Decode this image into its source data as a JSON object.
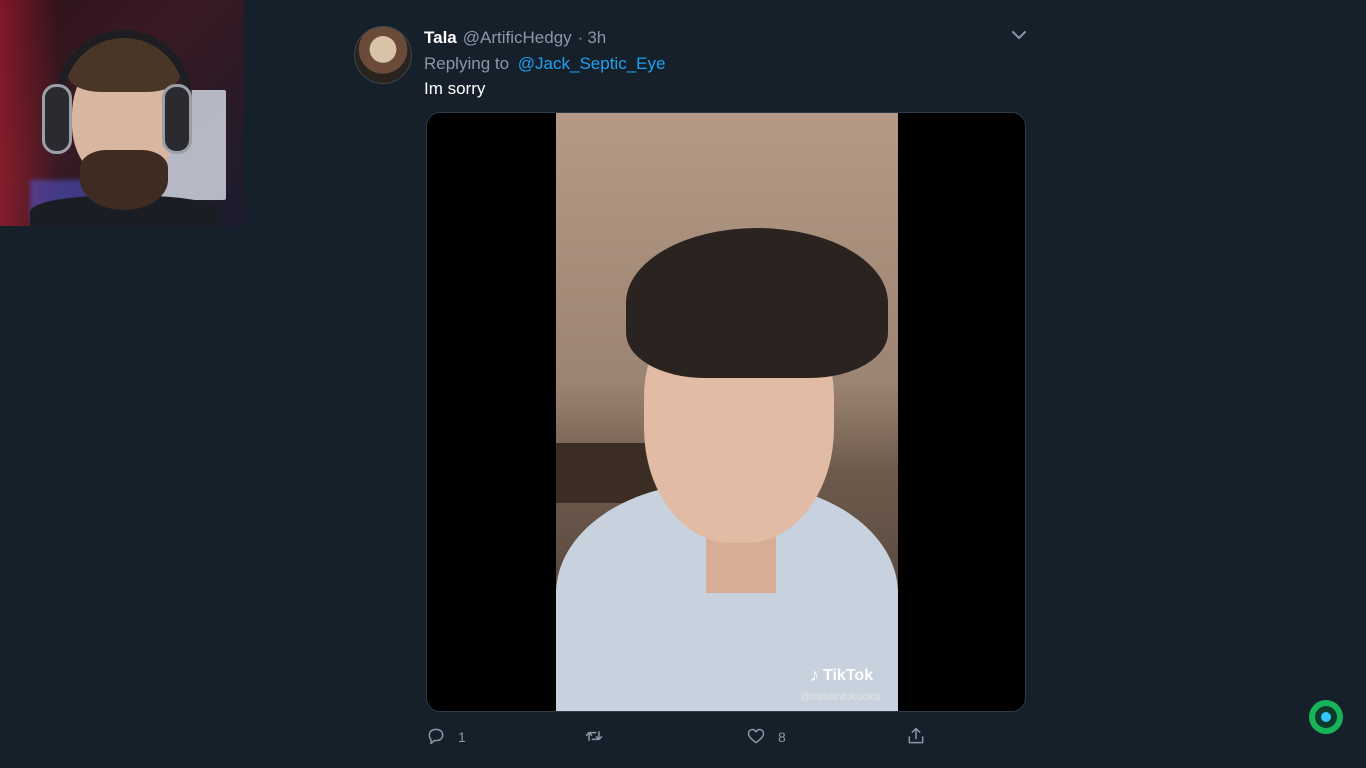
{
  "tweet": {
    "display_name": "Tala",
    "handle": "@ArtificHedgy",
    "separator": "·",
    "time": "3h",
    "replying_prefix": "Replying to",
    "replying_to": "@Jack_Septic_Eye",
    "text": "Im sorry",
    "media": {
      "watermark": "TikTok",
      "watermark_user": "@randinfukuoka"
    },
    "actions": {
      "reply_count": "1",
      "retweet_count": "",
      "like_count": "8"
    }
  },
  "icons": {
    "caret": "chevron-down-icon",
    "reply": "comment-icon",
    "retweet": "retweet-icon",
    "like": "heart-icon",
    "share": "share-icon",
    "corner_logo": "septic-eye-logo"
  },
  "colors": {
    "background": "#15202b",
    "secondary_text": "#8899a6",
    "link": "#1da1f2"
  }
}
